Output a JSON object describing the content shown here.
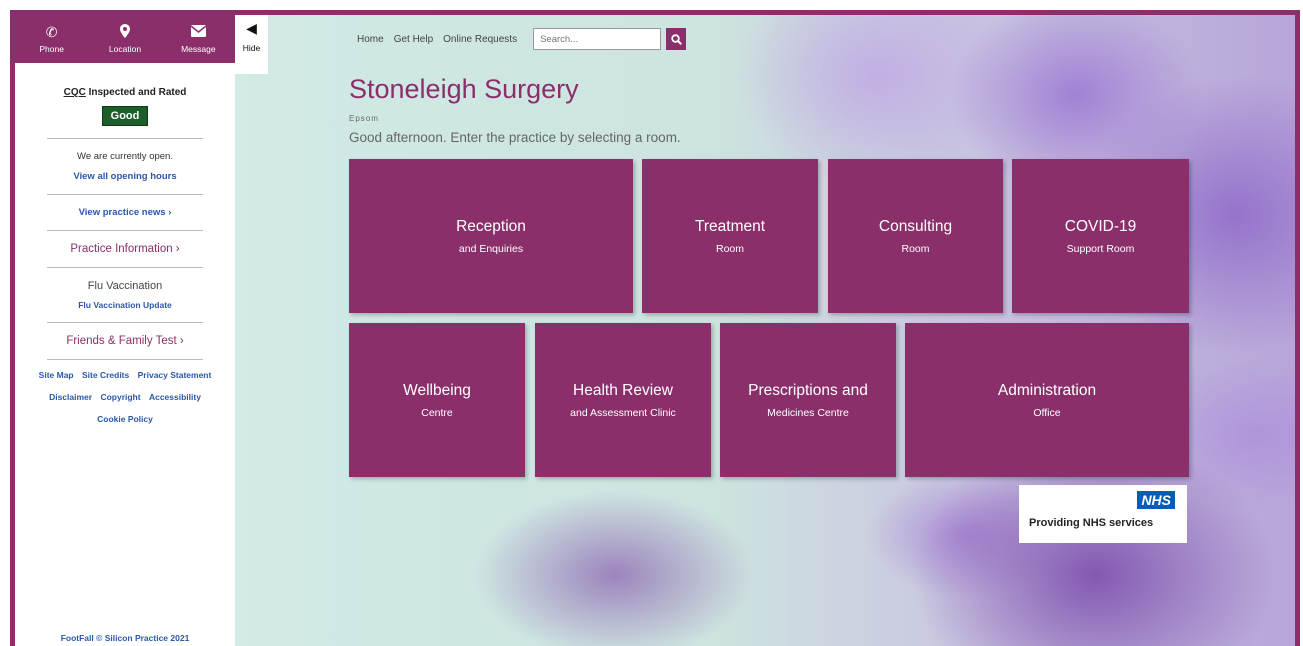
{
  "contact": {
    "phone": "Phone",
    "location": "Location",
    "message": "Message"
  },
  "hide_label": "Hide",
  "cqc": {
    "link": "CQC",
    "title_rest": " Inspected and Rated",
    "rating": "Good"
  },
  "opening": {
    "status_prefix": "We are currently ",
    "status": "open.",
    "link": "View all opening hours"
  },
  "news_link": "View practice news  ›",
  "practice_info": "Practice Information  ›",
  "flu": {
    "heading": "Flu Vaccination",
    "link": "Flu Vaccination Update"
  },
  "fft": "Friends & Family Test  ›",
  "footer": {
    "links": [
      "Site Map",
      "Site Credits",
      "Privacy Statement",
      "Disclaimer",
      "Copyright",
      "Accessibility",
      "Cookie Policy"
    ],
    "copyright": "FootFall © Silicon Practice 2021"
  },
  "nav": {
    "home": "Home",
    "get_help": "Get Help",
    "online_requests": "Online Requests",
    "search_placeholder": "Search..."
  },
  "practice": {
    "name": "Stoneleigh Surgery",
    "location": "Epsom",
    "greeting": "Good afternoon. Enter the practice by selecting a room."
  },
  "rooms": [
    {
      "title": "Reception",
      "sub": "and Enquiries"
    },
    {
      "title": "Treatment",
      "sub": "Room"
    },
    {
      "title": "Consulting",
      "sub": "Room"
    },
    {
      "title": "COVID-19",
      "sub": "Support Room"
    },
    {
      "title": "Wellbeing",
      "sub": "Centre"
    },
    {
      "title": "Health Review",
      "sub": "and Assessment Clinic"
    },
    {
      "title": "Prescriptions and",
      "sub": "Medicines Centre"
    },
    {
      "title": "Administration",
      "sub": "Office"
    }
  ],
  "nhs": {
    "logo": "NHS",
    "text": "Providing NHS services"
  },
  "colors": {
    "brand": "#8b2f6b",
    "cqc_good": "#1d5d2a",
    "link": "#2a58a8",
    "nhs_blue": "#005eb8"
  }
}
